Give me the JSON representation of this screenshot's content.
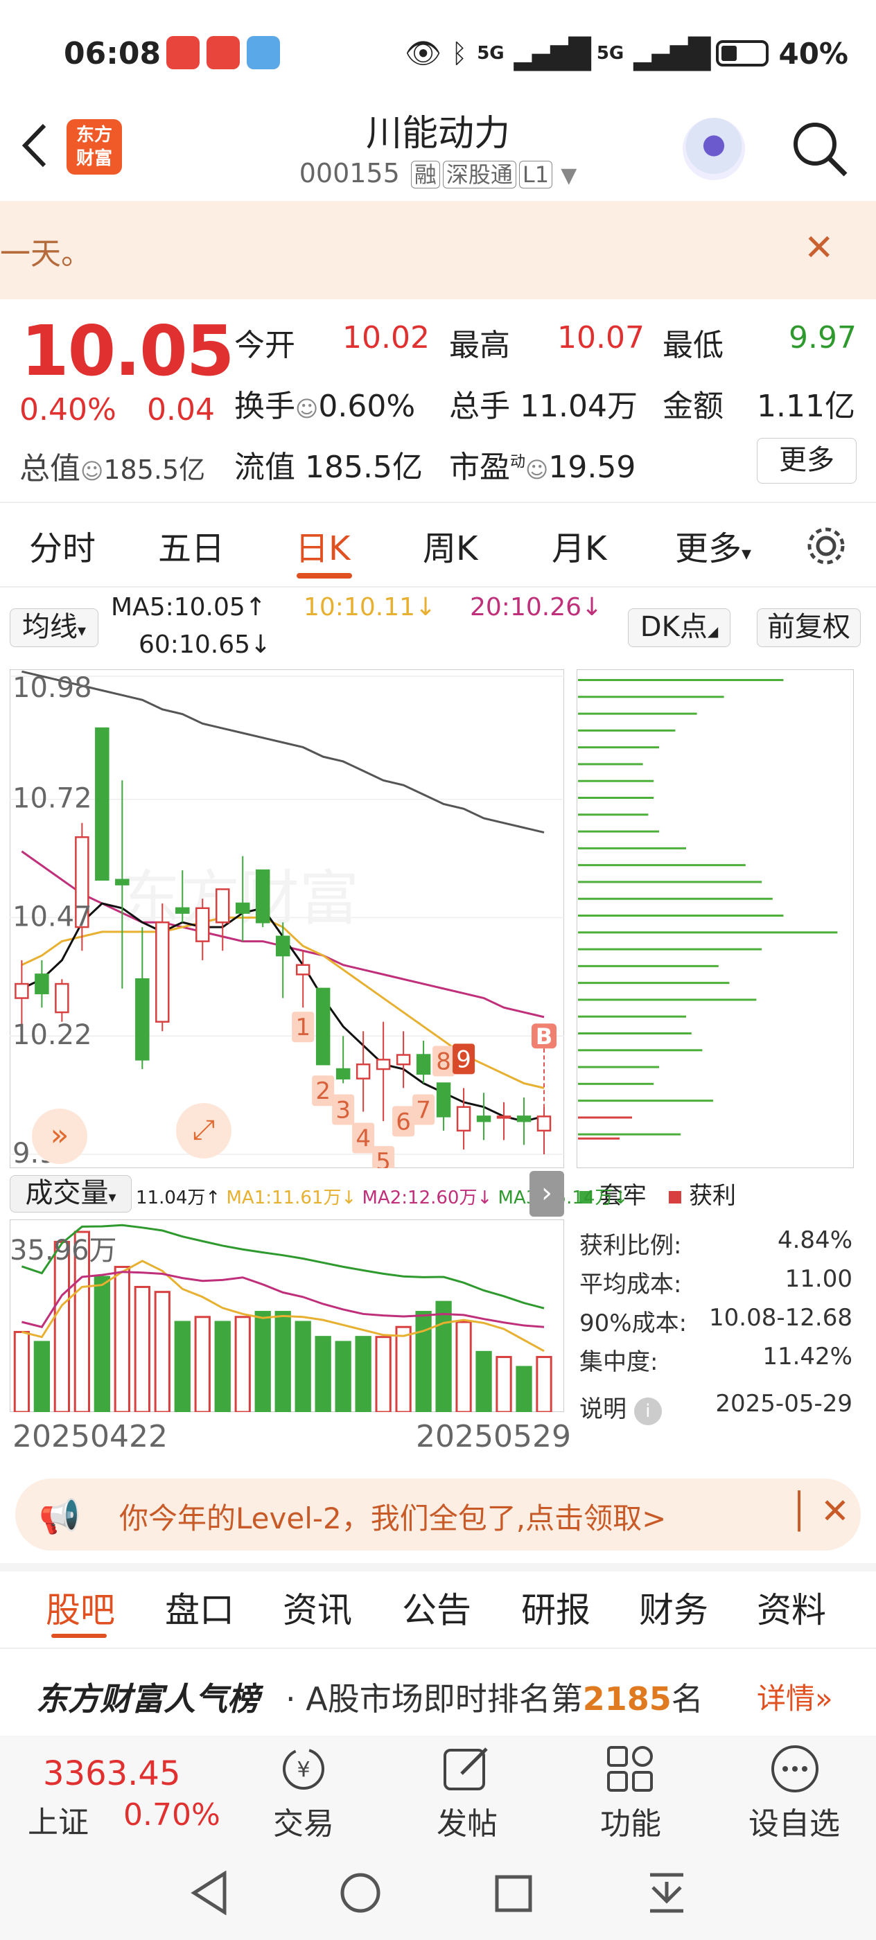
{
  "status_bar": {
    "time": "06:08",
    "battery": "40%",
    "net1": "5G",
    "net2": "5G"
  },
  "header": {
    "title": "川能动力",
    "code": "000155",
    "tags": [
      "融",
      "深股通",
      "L1"
    ],
    "logo_text": [
      "东方",
      "财富"
    ]
  },
  "notice": {
    "text": "一天。"
  },
  "quote": {
    "price": "10.05",
    "change_pct": "0.40%",
    "change": "0.04",
    "open_label": "今开",
    "open": "10.02",
    "high_label": "最高",
    "high": "10.07",
    "low_label": "最低",
    "low": "9.97",
    "turnover_label": "换手",
    "turnover": "0.60%",
    "volume_label": "总手",
    "volume": "11.04万",
    "amount_label": "金额",
    "amount": "1.11亿",
    "mktcap_label": "总值",
    "mktcap": "185.5亿",
    "float_label": "流值",
    "float": "185.5亿",
    "pe_label": "市盈",
    "pe_sup": "动",
    "pe": "19.59",
    "more": "更多"
  },
  "ktabs": [
    "分时",
    "五日",
    "日K",
    "周K",
    "月K",
    "更多"
  ],
  "ma": {
    "selector": "均线",
    "ma5": "MA5:10.05↑",
    "ma10": "10:10.11↓",
    "ma20": "20:10.26↓",
    "ma60": "60:10.65↓",
    "dk": "DK点",
    "adjust": "前复权",
    "colors": {
      "ma5": "#111111",
      "ma10": "#e8b030",
      "ma20": "#c0307a",
      "ma60": "#555555"
    }
  },
  "chart_data": [
    {
      "type": "candlestick",
      "y_ticks": [
        "10.98",
        "10.72",
        "10.47",
        "10.22",
        "9.97"
      ],
      "ylim": [
        9.97,
        10.98
      ],
      "candles": [
        {
          "o": 10.3,
          "h": 10.38,
          "l": 10.24,
          "c": 10.33
        },
        {
          "o": 10.35,
          "h": 10.38,
          "l": 10.28,
          "c": 10.31
        },
        {
          "o": 10.27,
          "h": 10.34,
          "l": 10.25,
          "c": 10.33
        },
        {
          "o": 10.45,
          "h": 10.67,
          "l": 10.4,
          "c": 10.64
        },
        {
          "o": 10.87,
          "h": 10.87,
          "l": 10.55,
          "c": 10.55
        },
        {
          "o": 10.55,
          "h": 10.76,
          "l": 10.32,
          "c": 10.54
        },
        {
          "o": 10.34,
          "h": 10.45,
          "l": 10.15,
          "c": 10.17
        },
        {
          "o": 10.25,
          "h": 10.5,
          "l": 10.23,
          "c": 10.46
        },
        {
          "o": 10.49,
          "h": 10.57,
          "l": 10.46,
          "c": 10.48
        },
        {
          "o": 10.42,
          "h": 10.51,
          "l": 10.38,
          "c": 10.49
        },
        {
          "o": 10.46,
          "h": 10.51,
          "l": 10.4,
          "c": 10.53
        },
        {
          "o": 10.5,
          "h": 10.6,
          "l": 10.42,
          "c": 10.48
        },
        {
          "o": 10.57,
          "h": 10.57,
          "l": 10.45,
          "c": 10.46
        },
        {
          "o": 10.43,
          "h": 10.46,
          "l": 10.3,
          "c": 10.39
        },
        {
          "o": 10.35,
          "h": 10.4,
          "l": 10.28,
          "c": 10.37
        },
        {
          "o": 10.32,
          "h": 10.32,
          "l": 10.16,
          "c": 10.16
        },
        {
          "o": 10.15,
          "h": 10.22,
          "l": 10.12,
          "c": 10.13
        },
        {
          "o": 10.13,
          "h": 10.23,
          "l": 10.06,
          "c": 10.16
        },
        {
          "o": 10.15,
          "h": 10.25,
          "l": 10.04,
          "c": 10.17
        },
        {
          "o": 10.16,
          "h": 10.23,
          "l": 10.11,
          "c": 10.18
        },
        {
          "o": 10.18,
          "h": 10.21,
          "l": 10.12,
          "c": 10.14
        },
        {
          "o": 10.12,
          "h": 10.12,
          "l": 10.02,
          "c": 10.05
        },
        {
          "o": 10.02,
          "h": 10.11,
          "l": 9.98,
          "c": 10.07
        },
        {
          "o": 10.05,
          "h": 10.1,
          "l": 10.0,
          "c": 10.04
        },
        {
          "o": 10.05,
          "h": 10.08,
          "l": 10.0,
          "c": 10.05
        },
        {
          "o": 10.05,
          "h": 10.09,
          "l": 9.99,
          "c": 10.04
        },
        {
          "o": 10.02,
          "h": 10.07,
          "l": 9.97,
          "c": 10.05
        }
      ],
      "ma5": [
        10.32,
        10.34,
        10.38,
        10.46,
        10.5,
        10.49,
        10.46,
        10.44,
        10.46,
        10.45,
        10.45,
        10.48,
        10.49,
        10.43,
        10.37,
        10.3,
        10.24,
        10.2,
        10.16,
        10.15,
        10.12,
        10.1,
        10.08,
        10.07,
        10.05,
        10.04,
        10.05
      ],
      "ma10": [
        10.37,
        10.39,
        10.42,
        10.43,
        10.44,
        10.44,
        10.44,
        10.44,
        10.45,
        10.46,
        10.47,
        10.47,
        10.47,
        10.45,
        10.41,
        10.39,
        10.36,
        10.33,
        10.3,
        10.27,
        10.24,
        10.21,
        10.18,
        10.16,
        10.14,
        10.12,
        10.11
      ],
      "ma20": [
        10.61,
        10.58,
        10.55,
        10.52,
        10.5,
        10.48,
        10.46,
        10.46,
        10.45,
        10.44,
        10.43,
        10.42,
        10.42,
        10.41,
        10.4,
        10.39,
        10.37,
        10.36,
        10.35,
        10.34,
        10.33,
        10.32,
        10.31,
        10.3,
        10.28,
        10.27,
        10.26
      ],
      "ma60_start_index": 0,
      "ma60_end_index": 26,
      "ma60": [
        10.99,
        10.98,
        10.97,
        10.96,
        10.95,
        10.94,
        10.93,
        10.91,
        10.9,
        10.88,
        10.87,
        10.86,
        10.85,
        10.84,
        10.83,
        10.81,
        10.8,
        10.78,
        10.76,
        10.75,
        10.73,
        10.71,
        10.7,
        10.68,
        10.67,
        10.66,
        10.65
      ],
      "sequence_labels": [
        "1",
        "2",
        "3",
        "4",
        "5",
        "6",
        "7",
        "8",
        "9"
      ],
      "marker": "B"
    },
    {
      "type": "bar",
      "title": "成交量",
      "ylabel_top": "35.96万",
      "legend": [
        "11.04万↑",
        "MA1:11.61万↓",
        "MA2:12.60万↓",
        "MA3:15.14万↓"
      ],
      "values": [
        16,
        14,
        34,
        36,
        27,
        29,
        25,
        24,
        18,
        19,
        18,
        19,
        20,
        20,
        18,
        15,
        14,
        15,
        15,
        17,
        20,
        22,
        18,
        12,
        11,
        9,
        11
      ],
      "up": [
        true,
        false,
        true,
        true,
        false,
        true,
        true,
        true,
        false,
        true,
        false,
        true,
        false,
        false,
        false,
        false,
        false,
        false,
        true,
        true,
        false,
        false,
        true,
        false,
        true,
        false,
        true
      ],
      "x_start": "20250422",
      "x_end": "20250529"
    }
  ],
  "chip": {
    "legend_trapped": "套牢",
    "legend_profit": "获利",
    "rows": [
      {
        "label": "获利比例:",
        "value": "4.84%"
      },
      {
        "label": "平均成本:",
        "value": "11.00"
      },
      {
        "label": "90%成本:",
        "value": "10.08-12.68"
      },
      {
        "label": "集中度:",
        "value": "11.42%"
      }
    ],
    "explain": "说明",
    "date": "2025-05-29",
    "bars": [
      0.76,
      0.54,
      0.44,
      0.36,
      0.3,
      0.24,
      0.28,
      0.28,
      0.26,
      0.3,
      0.4,
      0.62,
      0.68,
      0.72,
      0.76,
      0.96,
      0.68,
      0.52,
      0.56,
      0.66,
      0.4,
      0.42,
      0.46,
      0.3,
      0.28,
      0.5,
      0.2,
      0.38
    ]
  },
  "banner": {
    "text": "你今年的Level-2，我们全包了,点击领取>"
  },
  "bottom_tabs": [
    "股吧",
    "盘口",
    "资讯",
    "公告",
    "研报",
    "财务",
    "资料"
  ],
  "popularity": {
    "brand": "东方财富人气榜",
    "text_prefix": "· A股市场即时排名第",
    "rank": "2185",
    "text_suffix": "名",
    "detail": "详情"
  },
  "bottom_bar": {
    "index_value": "3363.45",
    "index_name": "上证",
    "index_change": "0.70%",
    "items": [
      "交易",
      "发帖",
      "功能",
      "设自选"
    ]
  }
}
